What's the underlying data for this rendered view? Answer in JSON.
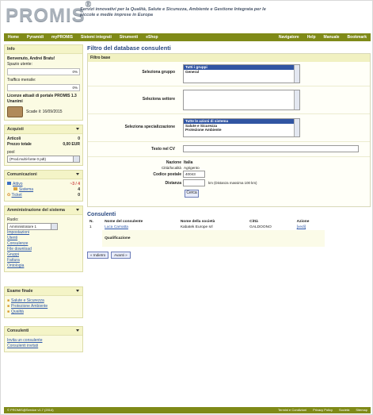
{
  "brand": {
    "logo": "PROMIS",
    "reg": "®",
    "tagline": "Servizi innovativi per la Qualità, Salute e Sicurezza, Ambiente e Gestione Integrata per le piccole e medie imprese in Europa"
  },
  "nav": {
    "left": [
      "Home",
      "Pyramidi",
      "myPROMIS",
      "Sistemi integrati",
      "Strumenti",
      "eShop"
    ],
    "right": [
      "Navigatore",
      "Help",
      "Manuale",
      "Bookmark"
    ]
  },
  "sidebar": {
    "info": {
      "title": "Info",
      "welcome": "Benvenuto, Andrei Bratu!",
      "space_label": "Spazio utente:",
      "space_value": "0%",
      "traffic_label": "Traffico mensile:",
      "traffic_value": "0%",
      "license_title": "Licenze attuali di portale PROMIS 1.3 Unanimi",
      "expiry": "Scade il: 16/09/2015"
    },
    "acquisti": {
      "title": "Acquisti",
      "articles_label": "Articoli",
      "articles_value": "0",
      "total_label": "Prezzo totale",
      "total_value": "0,00 EUR",
      "select_label": "pool",
      "select_value": "(Prod.multi-fonte 0 pdt)"
    },
    "comunicazioni": {
      "title": "Comunicazioni",
      "inbox_label": "Attivo",
      "inbox_count": "~3 / 4",
      "system_label": "Sistema",
      "system_count": "4",
      "tickets_label": "Ticket",
      "tickets_count": "0"
    },
    "admin": {
      "title": "Amministrazione del sistema",
      "role_label": "Ruolo:",
      "role_value": "Amministratore 1",
      "links": [
        "Impostazioni",
        "Utenti",
        "Consulenze",
        "File download",
        "Gruppi",
        "Fattura",
        "Ontologia"
      ]
    },
    "esami": {
      "title": "Esame finale",
      "items": [
        "Salute e Sicurezza",
        "Protezione Ambiente",
        "Qualità"
      ]
    },
    "consulenti": {
      "title": "Consulenti",
      "links": [
        "Invita un consulente",
        "Consulenti invitati"
      ]
    }
  },
  "main": {
    "title": "Filtro del database consulenti",
    "filter_header": "Filtro base",
    "group_label": "Seleziona gruppo",
    "group_options": [
      "Tutti i gruppi",
      "General"
    ],
    "sector_label": "Seleziona settore",
    "spec_label": "Seleziona specializzazione",
    "spec_options": [
      "Tutte le azioni di sistema",
      "Salute e Sicurezza",
      "Protezione Ambiente"
    ],
    "text_label": "Testo nel CV",
    "nation_label": "Nazione",
    "nation_value": "Italia",
    "city_label": "Città/località",
    "city_value": "Agrigento",
    "postal_label": "Codice postale",
    "postal_value": "40043",
    "distance_label": "Distanza",
    "distance_hint": "km   (Distanza massima 100 km)",
    "search_button": "Cerca",
    "results_title": "Consulenti",
    "table_headers": [
      "N.",
      "Nome del consulente",
      "Nome della società",
      "Città",
      "Azione"
    ],
    "rows": [
      {
        "n": "1",
        "name": "Luca Camatta",
        "company": "Kabatek Europe srl",
        "city": "GALDOONO",
        "action": "[vedi]"
      }
    ],
    "qualification_label": "Qualificazione",
    "back_button": "« Indietro",
    "next_button": "Avanti »"
  },
  "footer": {
    "left": "© PROMIS@Service v1.7 (2014)",
    "right": [
      "Termini e Condizioni",
      "Privacy Policy",
      "Società",
      "Sitemap"
    ]
  },
  "colors": {
    "nav_bg": "#7f8a18",
    "panel_bg": "#fbfbe3",
    "title_blue": "#2b4a82",
    "selected_blue": "#3155a3"
  }
}
